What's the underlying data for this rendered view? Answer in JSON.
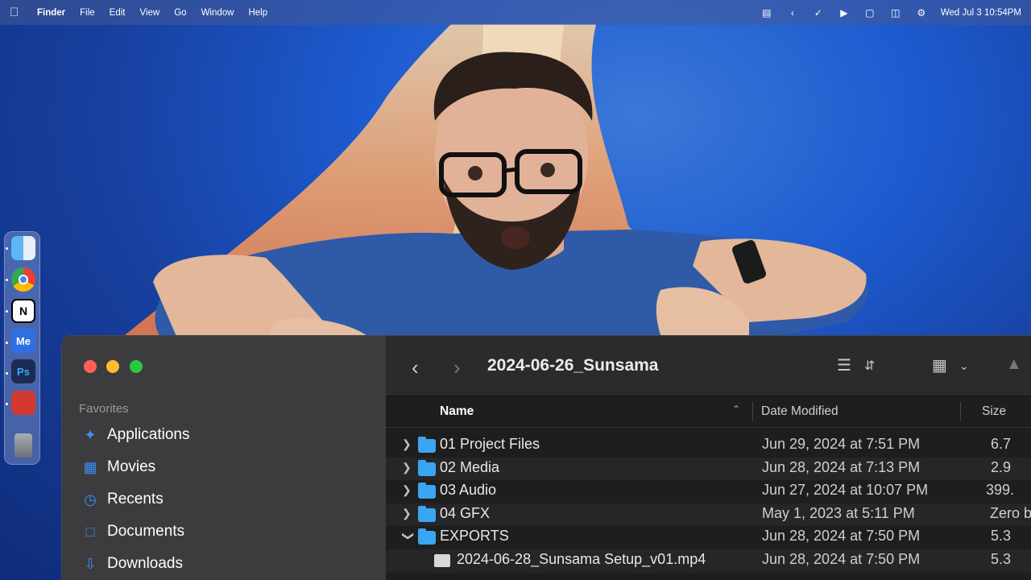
{
  "menubar": {
    "apple_icon": "apple-logo-icon",
    "items": [
      "Finder",
      "File",
      "Edit",
      "View",
      "Go",
      "Window",
      "Help"
    ],
    "clock": "Wed Jul 3  10:54PM"
  },
  "dock": {
    "apps": [
      "Finder",
      "Google Chrome",
      "Notion",
      "Adobe Media Encoder",
      "Photoshop",
      "Photo Booth",
      "Trash"
    ],
    "labels": [
      "",
      "",
      "N",
      "Me",
      "Ps",
      "",
      ""
    ]
  },
  "finder": {
    "title": "2024-06-26_Sunsama",
    "favorites_header": "Favorites",
    "sidebar": [
      {
        "label": "Applications",
        "icon": "applications-icon"
      },
      {
        "label": "Movies",
        "icon": "film-icon"
      },
      {
        "label": "Recents",
        "icon": "clock-icon"
      },
      {
        "label": "Documents",
        "icon": "document-icon"
      },
      {
        "label": "Downloads",
        "icon": "download-icon"
      }
    ],
    "columns": {
      "name": "Name",
      "date": "Date Modified",
      "size": "Size"
    },
    "rows": [
      {
        "name": "01 Project Files",
        "date": "Jun 29, 2024 at 7:51 PM",
        "size": "6.7",
        "kind": "folder",
        "expanded": false
      },
      {
        "name": "02 Media",
        "date": "Jun 28, 2024 at 7:13 PM",
        "size": "2.9",
        "kind": "folder",
        "expanded": false
      },
      {
        "name": "03 Audio",
        "date": "Jun 27, 2024 at 10:07 PM",
        "size": "399.",
        "kind": "folder",
        "expanded": false
      },
      {
        "name": "04 GFX",
        "date": "May 1, 2023 at 5:11 PM",
        "size": "Zero b",
        "kind": "folder",
        "expanded": false
      },
      {
        "name": "EXPORTS",
        "date": "Jun 28, 2024 at 7:50 PM",
        "size": "5.3",
        "kind": "folder",
        "expanded": true
      },
      {
        "name": "2024-06-28_Sunsama Setup_v01.mp4",
        "date": "Jun 28, 2024 at 7:50 PM",
        "size": "5.3",
        "kind": "video",
        "expanded": false
      }
    ]
  },
  "colors": {
    "accent": "#3a8ef5",
    "folder": "#3aa6f2",
    "close": "#ff5f57",
    "minimize": "#febc2e",
    "zoom": "#28c840"
  }
}
